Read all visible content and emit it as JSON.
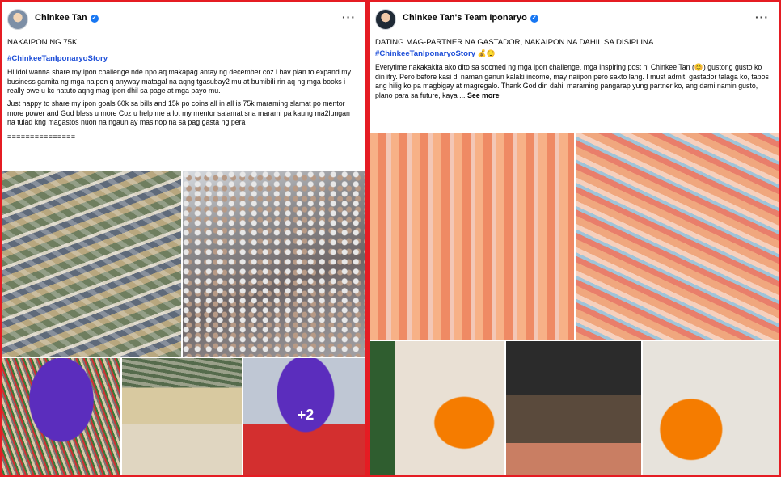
{
  "colors": {
    "frame": "#e51c23",
    "hashtag": "#1d4ed8",
    "verified": "#1877f2"
  },
  "left_post": {
    "author": "Chinkee Tan",
    "more_icon": "more-horizontal-icon",
    "title": "NAKAIPON NG 75K",
    "hashtag": "#ChinkeeTanIponaryoStory",
    "paragraph1": "Hi idol wanna share my ipon challenge nde npo aq makapag antay ng december coz i hav plan to expand my business gamita ng mga naipon q anyway matagal na aqng tgasubay2 mu at bumibili rin aq ng mga books i really owe u kc natuto aqng mag ipon dhil sa page at mga payo mu.",
    "paragraph2": "Just happy to share my ipon goals 60k sa bills and 15k po coins all in all is 75k maraming slamat po mentor more power and God bless u more Coz u help me a lot my mentor salamat sna marami pa kaung ma2lungan na tulad kng magastos nuon na ngaun ay masinop na sa pag gasta ng pera",
    "divider": "===============",
    "photos": [
      "banknotes-pile",
      "coins-pile",
      "piggy-bank-rolled-bills",
      "banknotes-stacks",
      "piggy-bank-red-envelopes"
    ],
    "extra_photos": "+2"
  },
  "right_post": {
    "author": "Chinkee Tan's Team Iponaryo",
    "more_icon": "more-horizontal-icon",
    "title": "DATING MAG-PARTNER NA GASTADOR, NAKAIPON NA DAHIL SA DISIPLINA",
    "hashtag": "#ChinkeeTanIponaryoStory",
    "hashtag_emoji": "💰😌",
    "body": "Everytime nakakakita ako dito sa socmed ng mga ipon challenge, mga inspiring post ni Chinkee Tan (😊) gustong gusto ko din itry. Pero before kasi di naman ganun kalaki income, may naiipon pero sakto lang. I must admit, gastador talaga ko, tapos ang hilig ko pa magbigay at magregalo. Thank God din dahil maraming pangarap yung partner ko, ang dami namin gusto, plano para sa future, kaya ...",
    "see_more": "See more",
    "photos": [
      "sorted-banknotes",
      "spread-banknotes",
      "couple-christmas-tree",
      "box-of-bills",
      "couple-holding-money"
    ]
  }
}
